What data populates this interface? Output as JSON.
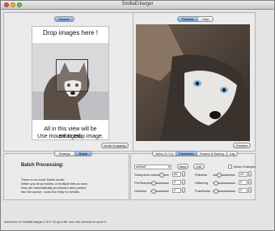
{
  "window": {
    "title": "SmillaEnlarger"
  },
  "source": {
    "tabs": [
      "Source",
      "Preview"
    ],
    "hint_top": "Drop images here !",
    "hint_bottom_1": "All in this view will be enlarged.",
    "hint_bottom_2": "Use mouse to crop image.",
    "undo_crop_label": "Undo Cropping"
  },
  "preview": {
    "tabs": [
      "Preview",
      "Help"
    ],
    "button_label": "Preview"
  },
  "batch": {
    "tabs": [
      "Enlarge",
      "Batch"
    ],
    "heading": "Batch Processing:",
    "lines": [
      "There is no more 'batch mode'.",
      "When you drop folders or multiple files at once,",
      "they are automatically processed and pushed",
      "into the queue. Look into Help for details."
    ]
  },
  "params": {
    "tabs": [
      "Jobs ( 0 / 0 )",
      "Parameter",
      "Source & Saving",
      "Log"
    ],
    "preset_value": "default",
    "new_label": "New",
    "del_label": "Del",
    "allow_changes_label": "Allow Changes",
    "rows": [
      {
        "left_label": "Sharpness",
        "left_value": "65",
        "left_level": 0.65,
        "right_label": "Flatness",
        "right_value": "20",
        "right_level": 0.2
      },
      {
        "left_label": "PreSharpen",
        "left_value": "0",
        "left_level": 0.0,
        "right_label": "Dithering",
        "right_value": "0",
        "right_level": 0.0
      },
      {
        "left_label": "DeNoise",
        "left_value": "0",
        "left_level": 0.0,
        "right_label": "FractNoise",
        "right_value": "0",
        "right_level": 0.0
      }
    ]
  },
  "status": {
    "text": "Welcome to SmillaEnlarger 0.8.9.  Drop a file onto the window to open it."
  }
}
